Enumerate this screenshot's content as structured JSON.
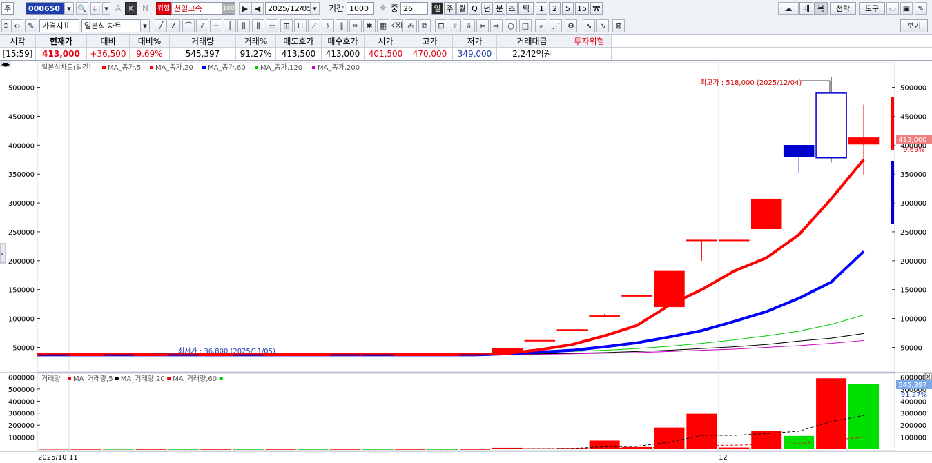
{
  "toolbar": {
    "market_label": "주",
    "stock_code": "000650",
    "letter_a": "A",
    "letter_k": "K",
    "letter_n": "N",
    "risk_badge": "위험",
    "stock_name": "천일고속",
    "stock_pct": "100",
    "date": "2025/12/05",
    "period_label": "기간",
    "period_value": "1000",
    "zoom_label": "중",
    "zoom_value": "26",
    "timeframes": [
      "일",
      "주",
      "월",
      "Q",
      "년",
      "분",
      "초",
      "틱",
      "1",
      "2",
      "5",
      "15",
      "₩"
    ],
    "right_buttons": [
      "매",
      "복",
      "전략",
      "도구"
    ],
    "indicator_dropdown": "가격지표",
    "chart_type_dropdown": "일본식 차트",
    "view_button": "보기"
  },
  "quote": {
    "headers": [
      "시각",
      "현재가",
      "대비",
      "대비%",
      "거래량",
      "거래%",
      "매도호가",
      "매수호가",
      "시가",
      "고가",
      "저가",
      "거래대금",
      "투자위험"
    ],
    "values": [
      "[15:59]",
      "413,000",
      "+36,500",
      "9.69%",
      "545,397",
      "91.27%",
      "413,500",
      "413,000",
      "401,500",
      "470,000",
      "349,000",
      "2,242억원",
      ""
    ]
  },
  "chart_data": [
    {
      "type": "candlestick",
      "legend_title": "일본식차트(일간)",
      "legend_items": [
        {
          "name": "MA_종가,5",
          "color": "#ff0000"
        },
        {
          "name": "MA_종가,20",
          "color": "#ff0000"
        },
        {
          "name": "MA_종가,60",
          "color": "#0000ff"
        },
        {
          "name": "MA_종가,120",
          "color": "#00cc00"
        },
        {
          "name": "MA_종가,200",
          "color": "#cc00cc"
        }
      ],
      "y_ticks": [
        50000,
        100000,
        150000,
        200000,
        250000,
        300000,
        350000,
        400000,
        450000,
        500000
      ],
      "y_tick_labels": [
        "50000",
        "100000",
        "150000",
        "200000",
        "250000",
        "300000",
        "350000",
        "400000",
        "450000",
        "500000"
      ],
      "ylim": [
        10000,
        540000
      ],
      "x_labels": [
        "2025/10",
        "11",
        "12"
      ],
      "annotation_high": "최고가 : 518,000 (2025/12/04)",
      "annotation_low": "최저가 : 36,800 (2025/11/05)",
      "current_price_label": "413,000",
      "current_pct_label": "9.69%",
      "candles": [
        {
          "o": 37500,
          "h": 38500,
          "l": 36900,
          "c": 37200
        },
        {
          "o": 37200,
          "h": 38000,
          "l": 36800,
          "c": 37500
        },
        {
          "o": 37500,
          "h": 38200,
          "l": 37000,
          "c": 37300
        },
        {
          "o": 37300,
          "h": 38000,
          "l": 36900,
          "c": 37600
        },
        {
          "o": 37600,
          "h": 38300,
          "l": 37200,
          "c": 37400
        },
        {
          "o": 37400,
          "h": 38000,
          "l": 37000,
          "c": 37500
        },
        {
          "o": 37500,
          "h": 38100,
          "l": 37100,
          "c": 37300
        },
        {
          "o": 37300,
          "h": 37900,
          "l": 36900,
          "c": 37400
        },
        {
          "o": 37400,
          "h": 38000,
          "l": 37000,
          "c": 37600
        },
        {
          "o": 37600,
          "h": 38200,
          "l": 37200,
          "c": 37500
        },
        {
          "o": 37500,
          "h": 38000,
          "l": 37100,
          "c": 37400
        },
        {
          "o": 37400,
          "h": 38000,
          "l": 37000,
          "c": 37500
        },
        {
          "o": 37500,
          "h": 38100,
          "l": 37200,
          "c": 37600
        },
        {
          "o": 37600,
          "h": 38200,
          "l": 37200,
          "c": 37500
        },
        {
          "o": 41000,
          "h": 48000,
          "l": 40000,
          "c": 48000
        },
        {
          "o": 62500,
          "h": 62500,
          "l": 62500,
          "c": 62500
        },
        {
          "o": 81000,
          "h": 81000,
          "l": 81000,
          "c": 81000
        },
        {
          "o": 105000,
          "h": 108000,
          "l": 105000,
          "c": 105000
        },
        {
          "o": 140000,
          "h": 140000,
          "l": 140000,
          "c": 140000
        },
        {
          "o": 120000,
          "h": 182000,
          "l": 120000,
          "c": 182000
        },
        {
          "o": 236000,
          "h": 236000,
          "l": 200000,
          "c": 236000
        },
        {
          "o": 236000,
          "h": 236000,
          "l": 236000,
          "c": 236000
        },
        {
          "o": 255000,
          "h": 307000,
          "l": 255000,
          "c": 307000
        },
        {
          "o": 400000,
          "h": 400000,
          "l": 352000,
          "c": 380000
        },
        {
          "o": 378000,
          "h": 518000,
          "l": 370000,
          "c": 490000
        },
        {
          "o": 401500,
          "h": 470000,
          "l": 349000,
          "c": 413000
        }
      ],
      "ma5": [
        37400,
        37400,
        37400,
        37400,
        37400,
        37400,
        37400,
        37400,
        37400,
        37400,
        37400,
        37400,
        37400,
        37500,
        39700,
        46000,
        55000,
        70000,
        88000,
        123000,
        150000,
        182000,
        205000,
        245000,
        307000,
        375000
      ],
      "ma20": [
        37000,
        37000,
        37000,
        37000,
        37000,
        37000,
        37000,
        37000,
        37000,
        37000,
        37000,
        37000,
        37000,
        37000,
        39000,
        42000,
        45000,
        51000,
        58000,
        68000,
        79000,
        95000,
        112000,
        135000,
        163000,
        216000
      ],
      "ma60": [
        37000,
        37000,
        37000,
        37000,
        37000,
        37000,
        37000,
        37000,
        37000,
        37000,
        37000,
        37000,
        37000,
        37000,
        39000,
        41000,
        43000,
        45000,
        48000,
        52000,
        57000,
        63000,
        70000,
        78000,
        90000,
        106000
      ],
      "ma120": [
        37000,
        37000,
        37000,
        37000,
        37000,
        37000,
        37000,
        37000,
        37000,
        37000,
        37000,
        37000,
        37000,
        37000,
        38000,
        39000,
        40000,
        41000,
        43000,
        45000,
        48000,
        51000,
        55000,
        61000,
        66000,
        74000
      ],
      "ma200": [
        36000,
        36000,
        36000,
        36000,
        36000,
        36000,
        36000,
        36000,
        36000,
        36000,
        36000,
        36000,
        36000,
        36000,
        37000,
        38000,
        39000,
        40000,
        41000,
        43000,
        45000,
        47000,
        50000,
        53000,
        57000,
        62000
      ]
    },
    {
      "type": "bar",
      "legend_title": "거래량",
      "legend_items": [
        {
          "name": "MA_거래량,5",
          "color": "#ff0000"
        },
        {
          "name": "MA_거래량,20",
          "color": "#000000"
        },
        {
          "name": "MA_거래량,60",
          "color": "#ff0000"
        }
      ],
      "extra_legend_color": "#00cc00",
      "y_ticks": [
        100000,
        200000,
        300000,
        400000,
        500000,
        600000
      ],
      "y_tick_labels": [
        "100000",
        "200000",
        "300000",
        "400000",
        "500000",
        "600000"
      ],
      "ylim": [
        0,
        620000
      ],
      "current_volume_label": "545,397",
      "current_pct_label": "91.27%",
      "volumes": [
        3000,
        2000,
        2000,
        1500,
        1500,
        1500,
        1500,
        1500,
        1500,
        1500,
        1500,
        1500,
        1500,
        1500,
        12000,
        8000,
        10000,
        72000,
        18000,
        180000,
        295000,
        14000,
        150000,
        110000,
        590000,
        545397
      ],
      "colors": [
        "red",
        "red",
        "green",
        "red",
        "green",
        "red",
        "green",
        "red",
        "green",
        "red",
        "green",
        "red",
        "green",
        "red",
        "red",
        "red",
        "red",
        "red",
        "red",
        "red",
        "red",
        "red",
        "red",
        "green",
        "red",
        "green"
      ],
      "ma5": [
        2000,
        2000,
        2000,
        2000,
        2000,
        2000,
        2000,
        2000,
        2000,
        2000,
        2000,
        2000,
        2000,
        2000,
        4000,
        5000,
        7000,
        20000,
        24000,
        58000,
        115000,
        115000,
        130000,
        150000,
        230000,
        280000
      ],
      "ma20": [
        2000,
        2000,
        2000,
        2000,
        2000,
        2000,
        2000,
        2000,
        2000,
        2000,
        2000,
        2000,
        2000,
        2000,
        3000,
        3500,
        4000,
        8000,
        9000,
        18000,
        32000,
        33000,
        40000,
        46000,
        75000,
        100000
      ]
    }
  ]
}
